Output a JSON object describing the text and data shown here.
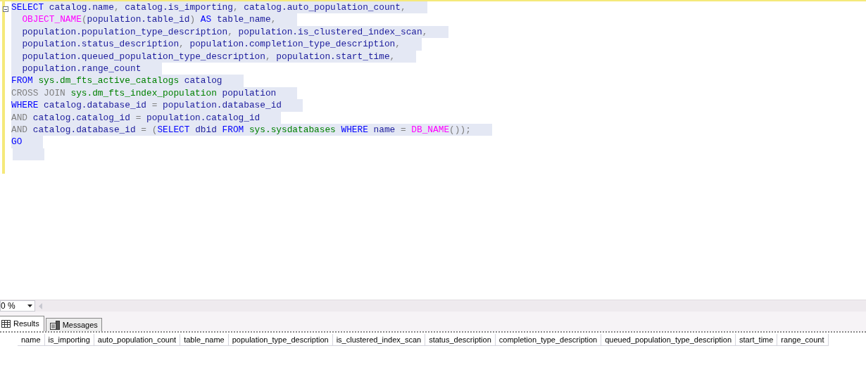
{
  "editor": {
    "lines": [
      {
        "tokens": [
          {
            "kind": "kw",
            "text": "SELECT"
          },
          {
            "kind": "plain",
            "text": " catalog.name"
          },
          {
            "kind": "op",
            "text": ", "
          },
          {
            "kind": "plain",
            "text": "catalog.is_importing"
          },
          {
            "kind": "op",
            "text": ", "
          },
          {
            "kind": "plain",
            "text": "catalog.auto_population_count"
          },
          {
            "kind": "op",
            "text": ","
          }
        ]
      },
      {
        "indent": true,
        "tokens": [
          {
            "kind": "fn",
            "text": "OBJECT_NAME"
          },
          {
            "kind": "op",
            "text": "("
          },
          {
            "kind": "plain",
            "text": "population.table_id"
          },
          {
            "kind": "op",
            "text": ")"
          },
          {
            "kind": "kw",
            "text": " AS"
          },
          {
            "kind": "plain",
            "text": " table_name"
          },
          {
            "kind": "op",
            "text": ","
          }
        ]
      },
      {
        "indent": true,
        "tokens": [
          {
            "kind": "plain",
            "text": "population.population_type_description"
          },
          {
            "kind": "op",
            "text": ", "
          },
          {
            "kind": "plain",
            "text": "population.is_clustered_index_scan"
          },
          {
            "kind": "op",
            "text": ","
          }
        ]
      },
      {
        "indent": true,
        "tokens": [
          {
            "kind": "plain",
            "text": "population.status_description"
          },
          {
            "kind": "op",
            "text": ", "
          },
          {
            "kind": "plain",
            "text": "population.completion_type_description"
          },
          {
            "kind": "op",
            "text": ","
          }
        ]
      },
      {
        "indent": true,
        "tokens": [
          {
            "kind": "plain",
            "text": "population.queued_population_type_description"
          },
          {
            "kind": "op",
            "text": ", "
          },
          {
            "kind": "plain",
            "text": "population.start_time"
          },
          {
            "kind": "op",
            "text": ","
          }
        ]
      },
      {
        "indent": true,
        "tokens": [
          {
            "kind": "plain",
            "text": "population.range_count"
          }
        ]
      },
      {
        "tokens": [
          {
            "kind": "kw",
            "text": "FROM"
          },
          {
            "kind": "sys",
            "text": " sys.dm_fts_active_catalogs"
          },
          {
            "kind": "plain",
            "text": " catalog"
          }
        ]
      },
      {
        "tokens": [
          {
            "kind": "op",
            "text": "CROSS JOIN"
          },
          {
            "kind": "sys",
            "text": " sys.dm_fts_index_population"
          },
          {
            "kind": "plain",
            "text": " population"
          }
        ]
      },
      {
        "tokens": [
          {
            "kind": "kw",
            "text": "WHERE"
          },
          {
            "kind": "plain",
            "text": " catalog.database_id "
          },
          {
            "kind": "op",
            "text": "="
          },
          {
            "kind": "plain",
            "text": " population.database_id"
          }
        ]
      },
      {
        "tokens": [
          {
            "kind": "op",
            "text": "AND"
          },
          {
            "kind": "plain",
            "text": " catalog.catalog_id "
          },
          {
            "kind": "op",
            "text": "="
          },
          {
            "kind": "plain",
            "text": " population.catalog_id"
          }
        ]
      },
      {
        "tokens": [
          {
            "kind": "op",
            "text": "AND"
          },
          {
            "kind": "plain",
            "text": " catalog.database_id "
          },
          {
            "kind": "op",
            "text": "= ("
          },
          {
            "kind": "kw",
            "text": "SELECT"
          },
          {
            "kind": "plain",
            "text": " dbid "
          },
          {
            "kind": "kw",
            "text": "FROM"
          },
          {
            "kind": "sys",
            "text": " sys.sysdatabases"
          },
          {
            "kind": "kw",
            "text": " WHERE"
          },
          {
            "kind": "plain",
            "text": " name "
          },
          {
            "kind": "op",
            "text": "= "
          },
          {
            "kind": "fn",
            "text": "DB_NAME"
          },
          {
            "kind": "op",
            "text": "());"
          }
        ]
      },
      {
        "tokens": [
          {
            "kind": "kw",
            "text": "GO"
          }
        ]
      }
    ]
  },
  "zoom": {
    "value": "0 %"
  },
  "tabs": [
    {
      "label": "Results",
      "selected": true
    },
    {
      "label": "Messages",
      "selected": false
    }
  ],
  "results": {
    "columns": [
      "name",
      "is_importing",
      "auto_population_count",
      "table_name",
      "population_type_description",
      "is_clustered_index_scan",
      "status_description",
      "completion_type_description",
      "queued_population_type_description",
      "start_time",
      "range_count"
    ]
  }
}
